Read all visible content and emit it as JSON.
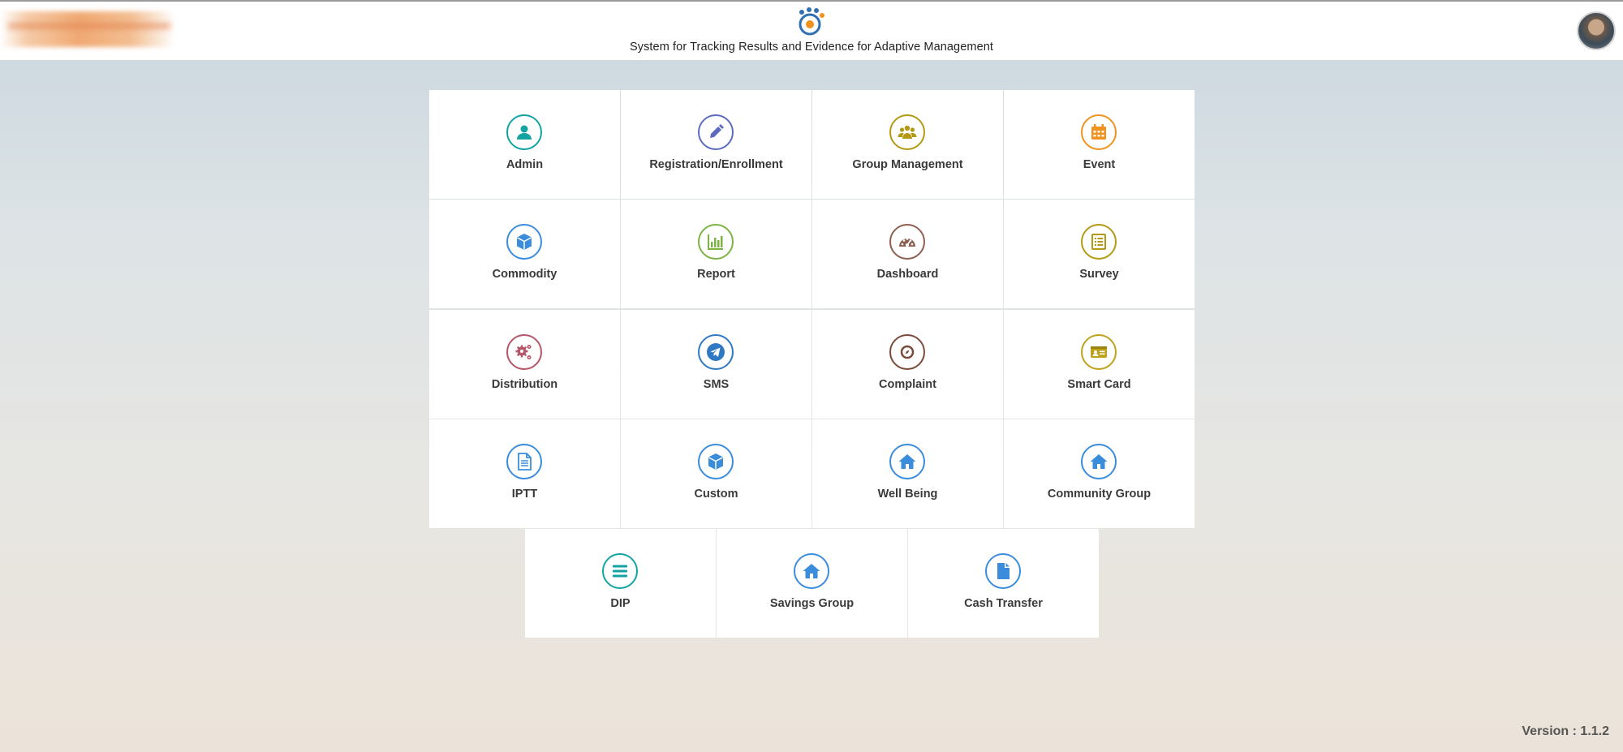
{
  "header": {
    "title": "System for Tracking Results and Evidence for Adaptive Management"
  },
  "colors": {
    "teal": "#13a3a3",
    "indigo": "#5c6bc0",
    "olive": "#b39a12",
    "orange": "#f0921d",
    "blue": "#3b8ddb",
    "green": "#7cb342",
    "brown": "#8d5f52",
    "rose": "#b5566b",
    "navy": "#2f78c4",
    "maroon": "#7a4b3a",
    "mustard": "#c0a21a"
  },
  "modules": [
    {
      "label": "Admin",
      "icon": "user-icon",
      "color": "#13a3a3"
    },
    {
      "label": "Registration/Enrollment",
      "icon": "pencil-icon",
      "color": "#5c6bc0"
    },
    {
      "label": "Group Management",
      "icon": "group-icon",
      "color": "#b39a12"
    },
    {
      "label": "Event",
      "icon": "calendar-icon",
      "color": "#f0921d"
    },
    {
      "label": "Commodity",
      "icon": "cube-icon",
      "color": "#3b8ddb"
    },
    {
      "label": "Report",
      "icon": "bar-chart-icon",
      "color": "#7cb342"
    },
    {
      "label": "Dashboard",
      "icon": "gauge-icon",
      "color": "#8d5f52"
    },
    {
      "label": "Survey",
      "icon": "list-icon",
      "color": "#b39a12"
    },
    {
      "label": "Distribution",
      "icon": "gears-icon",
      "color": "#b5566b"
    },
    {
      "label": "SMS",
      "icon": "paper-plane-icon",
      "color": "#2f78c4"
    },
    {
      "label": "Complaint",
      "icon": "compass-icon",
      "color": "#7a4b3a"
    },
    {
      "label": "Smart Card",
      "icon": "id-card-icon",
      "color": "#c0a21a"
    },
    {
      "label": "IPTT",
      "icon": "document-icon",
      "color": "#3b8ddb"
    },
    {
      "label": "Custom",
      "icon": "cube-icon",
      "color": "#3b8ddb"
    },
    {
      "label": "Well Being",
      "icon": "home-icon",
      "color": "#3b8ddb"
    },
    {
      "label": "Community Group",
      "icon": "home-icon",
      "color": "#3b8ddb"
    },
    {
      "label": "DIP",
      "icon": "menu-icon",
      "color": "#13a3a3"
    },
    {
      "label": "Savings Group",
      "icon": "home-icon",
      "color": "#3b8ddb"
    },
    {
      "label": "Cash Transfer",
      "icon": "file-icon",
      "color": "#3b8ddb"
    }
  ],
  "footer": {
    "version": "Version : 1.1.2"
  }
}
